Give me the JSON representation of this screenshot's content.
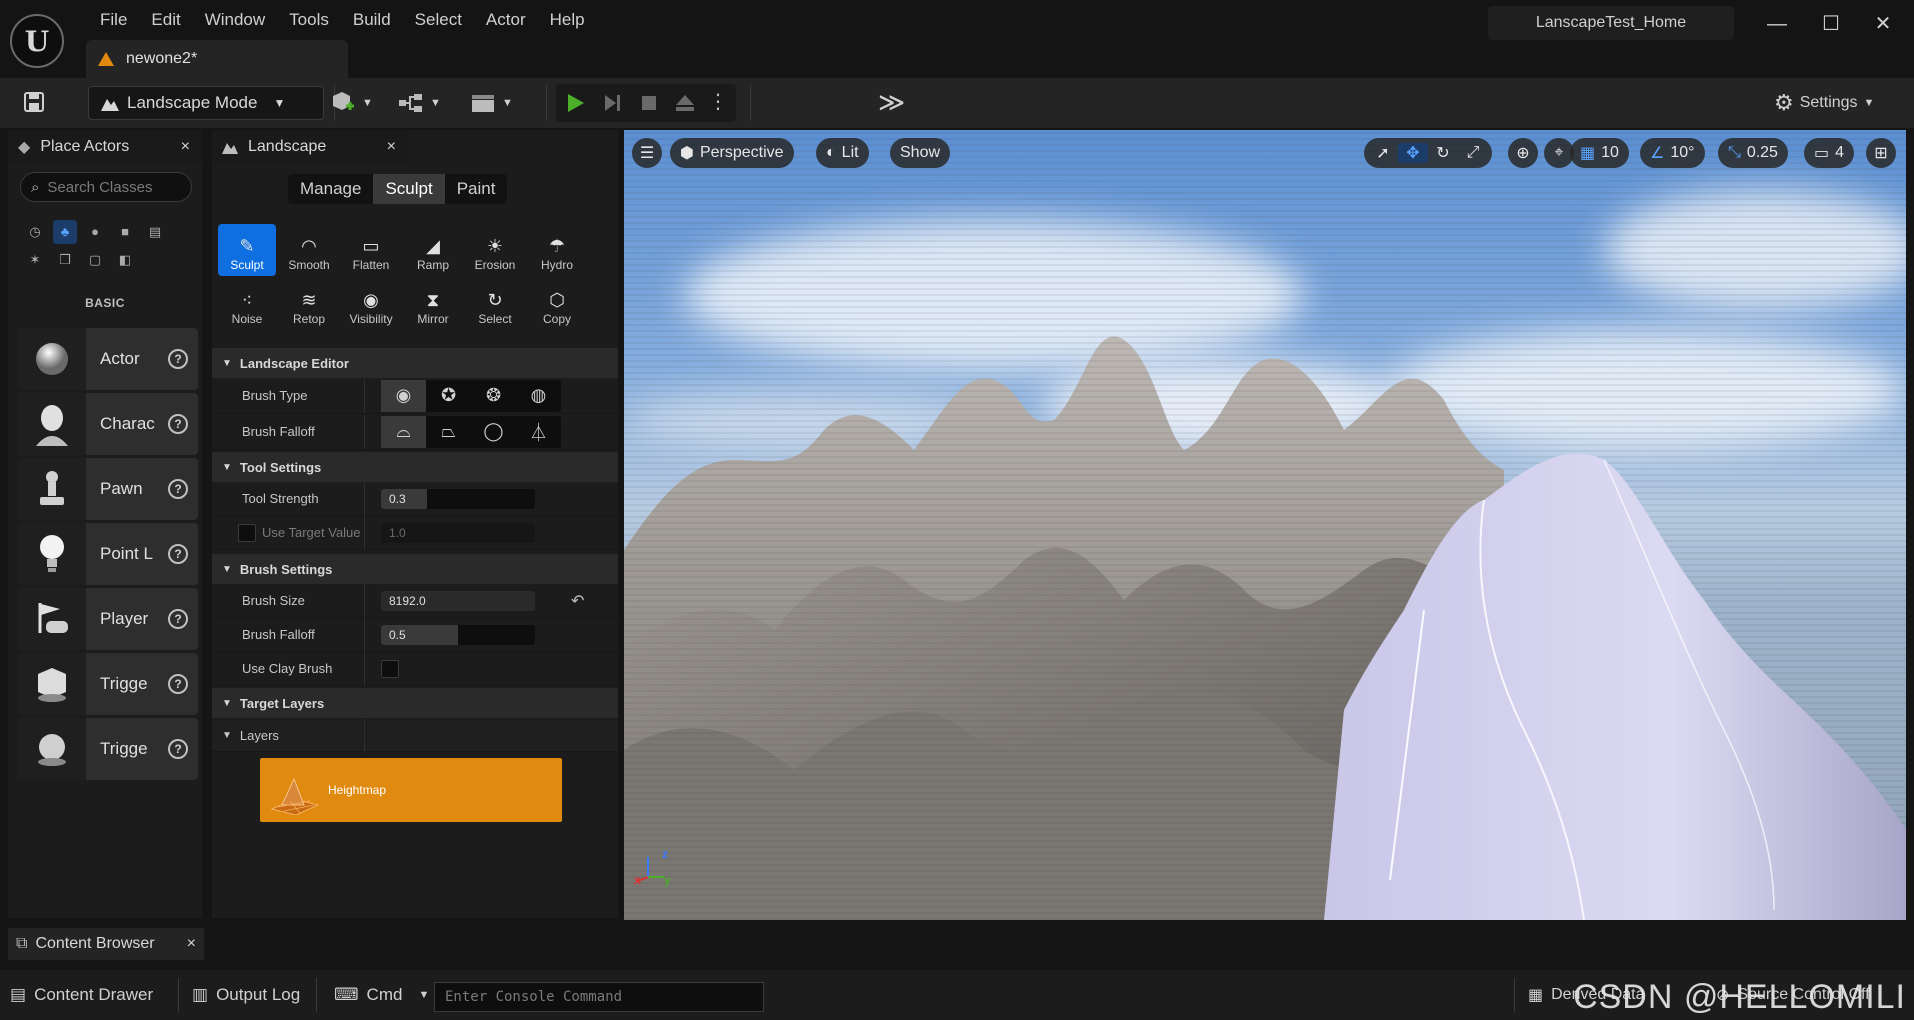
{
  "window": {
    "logo_text": "U",
    "menu": [
      "File",
      "Edit",
      "Window",
      "Tools",
      "Build",
      "Select",
      "Actor",
      "Help"
    ],
    "document_tab": "newone2*",
    "project_title": "LanscapeTest_Home",
    "controls": {
      "minimize": "—",
      "maximize": "☐",
      "close": "✕"
    }
  },
  "toolbar": {
    "mode": "Landscape Mode",
    "settings": "Settings",
    "more": "≫"
  },
  "place_actors": {
    "title": "Place Actors",
    "close": "×",
    "search_placeholder": "Search Classes",
    "category_label": "BASIC",
    "items": [
      {
        "label": "Actor",
        "icon": "sphere"
      },
      {
        "label": "Charac",
        "icon": "character"
      },
      {
        "label": "Pawn",
        "icon": "pawn"
      },
      {
        "label": "Point L",
        "icon": "light-bulb"
      },
      {
        "label": "Player",
        "icon": "player-start"
      },
      {
        "label": "Trigge",
        "icon": "trigger-box"
      },
      {
        "label": "Trigge",
        "icon": "trigger-sphere"
      }
    ]
  },
  "landscape": {
    "title": "Landscape",
    "close": "×",
    "modes": [
      "Manage",
      "Sculpt",
      "Paint"
    ],
    "active_mode": "Sculpt",
    "tools": [
      {
        "label": "Sculpt",
        "glyph": "✎"
      },
      {
        "label": "Smooth",
        "glyph": "◠"
      },
      {
        "label": "Flatten",
        "glyph": "▭"
      },
      {
        "label": "Ramp",
        "glyph": "◢"
      },
      {
        "label": "Erosion",
        "glyph": "☀"
      },
      {
        "label": "Hydro",
        "glyph": "☂"
      },
      {
        "label": "Noise",
        "glyph": "⁖"
      },
      {
        "label": "Retop",
        "glyph": "≋"
      },
      {
        "label": "Visibility",
        "glyph": "◉"
      },
      {
        "label": "Mirror",
        "glyph": "⧗"
      },
      {
        "label": "Select",
        "glyph": "↻"
      },
      {
        "label": "Copy",
        "glyph": "⬡"
      }
    ],
    "active_tool": "Sculpt",
    "sections": {
      "landscape_editor": "Landscape Editor",
      "tool_settings": "Tool Settings",
      "brush_settings": "Brush Settings",
      "target_layers": "Target Layers",
      "layers": "Layers"
    },
    "brush_type_label": "Brush Type",
    "brush_falloff_label": "Brush Falloff",
    "tool_strength": {
      "label": "Tool Strength",
      "value": "0.3",
      "fraction": 0.3
    },
    "use_target_value": {
      "label": "Use Target Value",
      "value": "1.0"
    },
    "brush_size": {
      "label": "Brush Size",
      "value": "8192.0"
    },
    "brush_falloff": {
      "label": "Brush Falloff",
      "value": "0.5",
      "fraction": 0.5
    },
    "use_clay_brush": {
      "label": "Use Clay Brush",
      "checked": false
    },
    "layer_name": "Heightmap"
  },
  "viewport": {
    "view": "Perspective",
    "lighting": "Lit",
    "show": "Show",
    "grid_snap": "10",
    "rotation_snap": "10°",
    "scale_snap": "0.25",
    "camera_speed": "4",
    "axis_x": "x",
    "axis_y": "y",
    "axis_z": "z"
  },
  "bottom": {
    "content_browser": "Content Browser",
    "content_drawer": "Content Drawer",
    "output_log": "Output Log",
    "cmd": "Cmd",
    "console_placeholder": "Enter Console Command",
    "derived_data": "Derived Data",
    "source_control": "Source Control Off",
    "watermark": "CSDN @HELLOMILI"
  },
  "colors": {
    "accent": "#0f6fe0",
    "heightmap": "#e08a10",
    "play": "#4caf2a"
  }
}
